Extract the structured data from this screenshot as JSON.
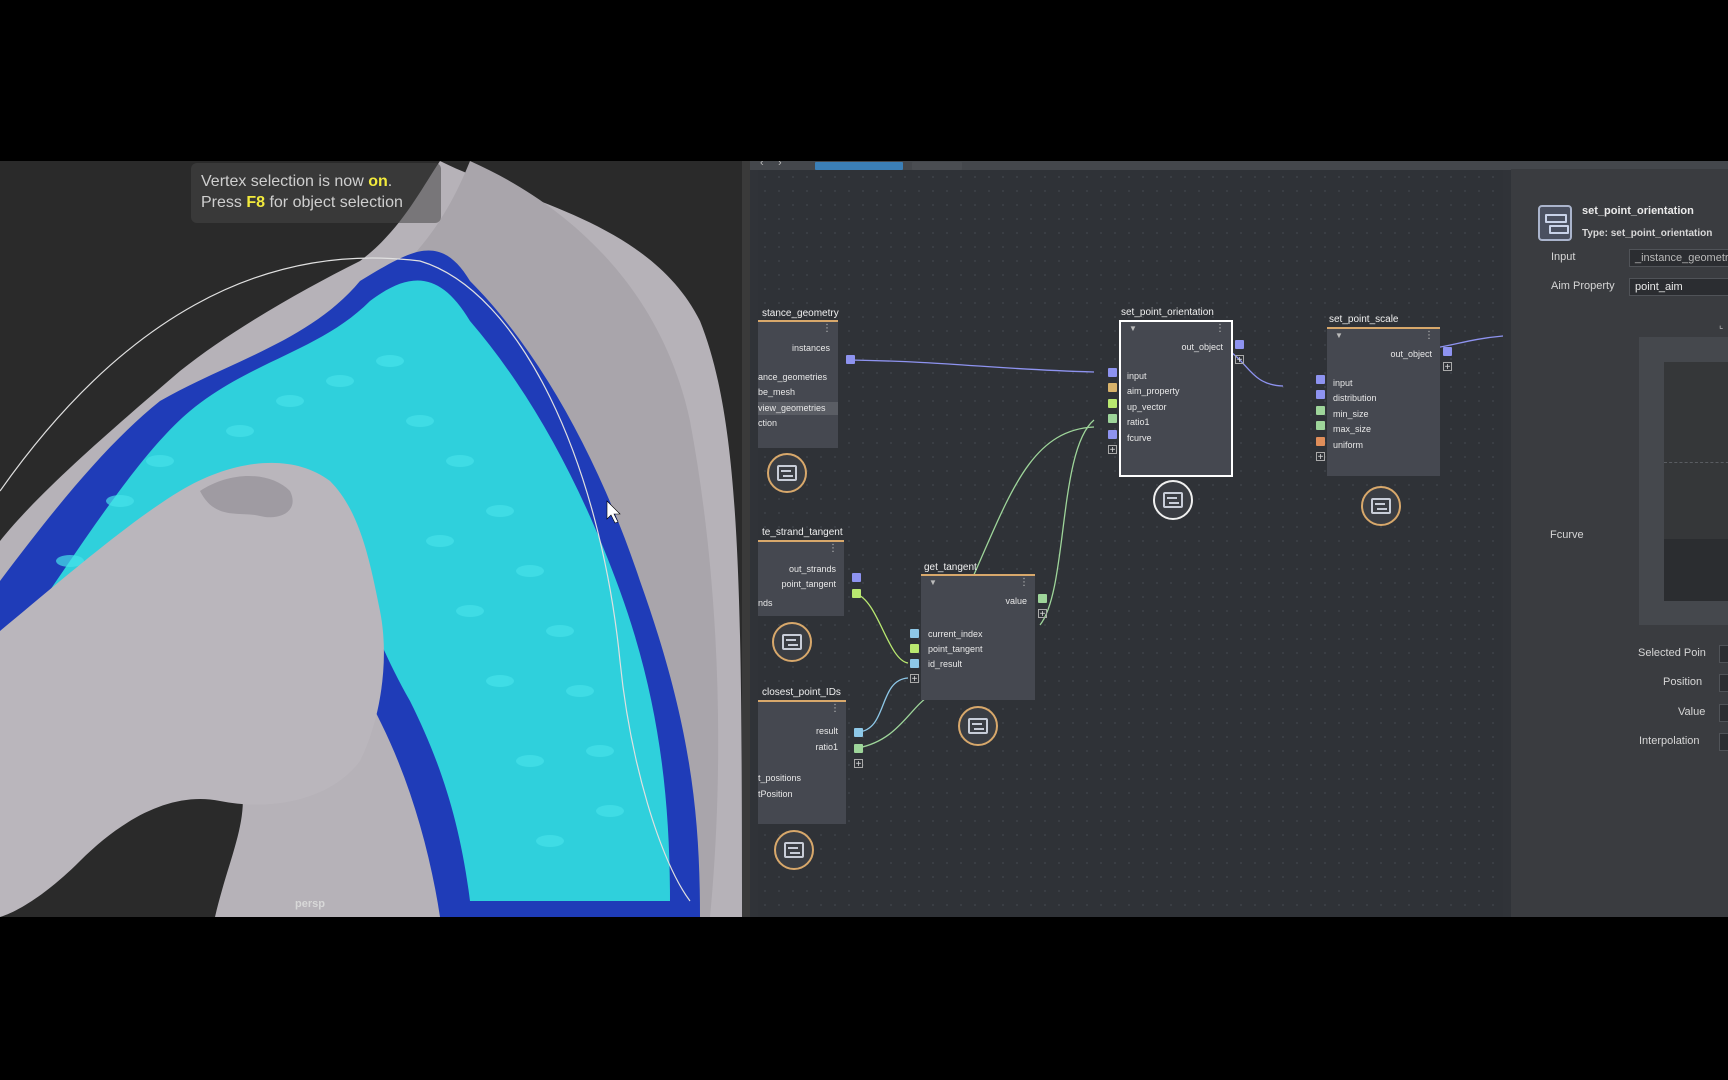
{
  "viewport": {
    "hud_line1_prefix": "Vertex selection is now ",
    "hud_line1_highlight": "on",
    "hud_line1_suffix": ".",
    "hud_line2_prefix": "Press ",
    "hud_line2_key": "F8",
    "hud_line2_suffix": " for object selection",
    "camera_label": "persp"
  },
  "editor": {
    "nodes": {
      "instance_geometry": {
        "title": "stance_geometry",
        "out_instances": "instances",
        "in_instance_geometries": "ance_geometries",
        "in_cube_mesh": "be_mesh",
        "in_view_geometries": "view_geometries",
        "in_selection": "ction"
      },
      "strand_tangent": {
        "title": "te_strand_tangent",
        "out_strands": "out_strands",
        "out_point_tangent": "point_tangent",
        "in_strands": "nds"
      },
      "closest_point": {
        "title": "closest_point_IDs",
        "out_result": "result",
        "out_ratio1": "ratio1",
        "in_positions": "t_positions",
        "in_position": "tPosition"
      },
      "get_tangent": {
        "title": "get_tangent",
        "out_value": "value",
        "in_current_index": "current_index",
        "in_point_tangent": "point_tangent",
        "in_id_result": "id_result"
      },
      "set_point_orientation": {
        "title": "set_point_orientation",
        "out_object": "out_object",
        "in_input": "input",
        "in_aim_property": "aim_property",
        "in_up_vector": "up_vector",
        "in_ratio1": "ratio1",
        "in_fcurve": "fcurve"
      },
      "set_point_scale": {
        "title": "set_point_scale",
        "out_object": "out_object",
        "in_input": "input",
        "in_distribution": "distribution",
        "in_min_size": "min_size",
        "in_max_size": "max_size",
        "in_uniform": "uniform"
      }
    }
  },
  "attr": {
    "node_name": "set_point_orientation",
    "node_type": "Type: set_point_orientation",
    "input_label": "Input",
    "input_value": "_instance_geometry",
    "aim_label": "Aim Property",
    "aim_value": "point_aim",
    "fcurve_label": "Fcurve",
    "selected_point_label": "Selected Poin",
    "position_label": "Position",
    "value_label": "Value",
    "interpolation_label": "Interpolation"
  },
  "colors": {
    "pin_blue": "#8e93f0",
    "pin_yellow": "#d9b36a",
    "pin_green": "#9ed59a",
    "pin_cyan": "#8ec8e8",
    "pin_orange": "#e08e5a",
    "pin_lime": "#b9e870",
    "node_accent": "#d8a86b"
  }
}
